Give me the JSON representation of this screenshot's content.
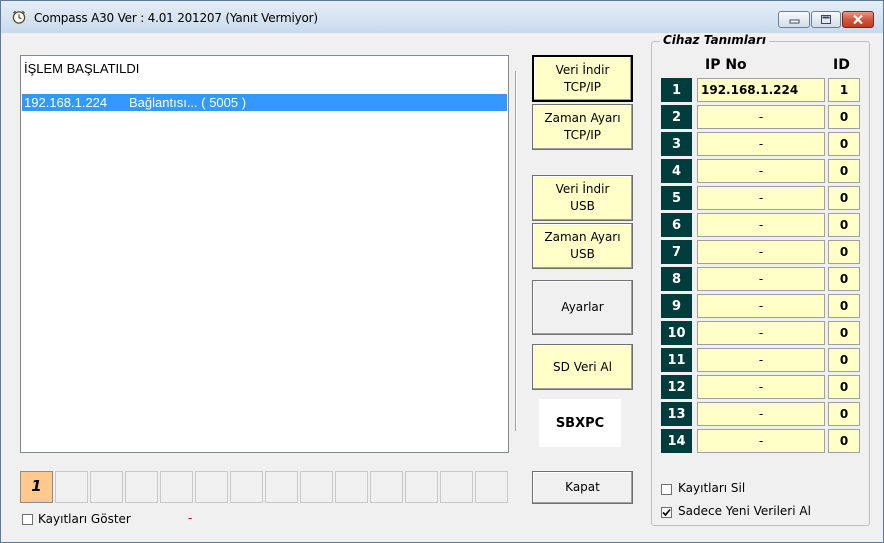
{
  "window": {
    "title": "Compass  A30  Ver : 4.01  201207 (Yanıt Vermiyor)",
    "minimize_label": "",
    "maximize_label": "",
    "close_label": ""
  },
  "log": {
    "lines": [
      {
        "text": "İŞLEM BAŞLATILDI"
      },
      {
        "ip": "192.168.1.224",
        "status": "Bağlantısı... ( 5005 )",
        "selected": true
      }
    ]
  },
  "buttons": {
    "veri_indir_tcp": [
      "Veri İndir",
      "TCP/IP"
    ],
    "zaman_ayari_tcp": [
      "Zaman Ayarı",
      "TCP/IP"
    ],
    "veri_indir_usb": [
      "Veri İndir",
      "USB"
    ],
    "zaman_ayari_usb": [
      "Zaman Ayarı",
      "USB"
    ],
    "ayarlar": "Ayarlar",
    "sd_veri_al": "SD Veri Al",
    "kapat": "Kapat"
  },
  "brand_label": "SBXPC",
  "pager": {
    "active_page": "1",
    "total_cells": 14
  },
  "options": {
    "kayitlari_goster": {
      "label": "Kayıtları Göster",
      "checked": false
    },
    "status_dash": "-",
    "kayitlari_sil": {
      "label": "Kayıtları Sil",
      "checked": false
    },
    "sadece_yeni": {
      "label": "Sadece Yeni Verileri Al",
      "checked": true
    }
  },
  "devices": {
    "title": "Cihaz Tanımları",
    "ip_header": "IP No",
    "id_header": "ID",
    "rows": [
      {
        "num": "1",
        "ip": "192.168.1.224",
        "id": "1"
      },
      {
        "num": "2",
        "ip": "-",
        "id": "0"
      },
      {
        "num": "3",
        "ip": "-",
        "id": "0"
      },
      {
        "num": "4",
        "ip": "-",
        "id": "0"
      },
      {
        "num": "5",
        "ip": "-",
        "id": "0"
      },
      {
        "num": "6",
        "ip": "-",
        "id": "0"
      },
      {
        "num": "7",
        "ip": "-",
        "id": "0"
      },
      {
        "num": "8",
        "ip": "-",
        "id": "0"
      },
      {
        "num": "9",
        "ip": "-",
        "id": "0"
      },
      {
        "num": "10",
        "ip": "-",
        "id": "0"
      },
      {
        "num": "11",
        "ip": "-",
        "id": "0"
      },
      {
        "num": "12",
        "ip": "-",
        "id": "0"
      },
      {
        "num": "13",
        "ip": "-",
        "id": "0"
      },
      {
        "num": "14",
        "ip": "-",
        "id": "0"
      }
    ]
  },
  "colors": {
    "button_yellow": "#ffffc8",
    "device_number_bg": "#003c3c",
    "selection_blue": "#3399ff",
    "active_page": "#ffc88c",
    "status_dash": "#d00000"
  }
}
